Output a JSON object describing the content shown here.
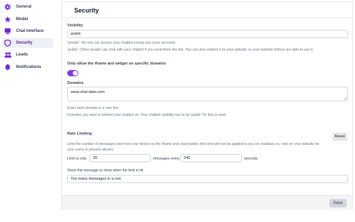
{
  "sidebar": {
    "items": [
      {
        "label": "General",
        "icon": "gear-icon"
      },
      {
        "label": "Model",
        "icon": "star-icon"
      },
      {
        "label": "Chat Interface",
        "icon": "chat-window-icon"
      },
      {
        "label": "Security",
        "icon": "shield-icon"
      },
      {
        "label": "Leads",
        "icon": "users-icon"
      },
      {
        "label": "Notifications",
        "icon": "bell-icon"
      }
    ],
    "active": "Security"
  },
  "security": {
    "title": "Security",
    "visibility": {
      "label": "Visibility",
      "value": "public",
      "help_private": "'private': No one can access your chatbot except you (your account)",
      "help_public": "'public': Other people can chat with your chatbot if you send them the link. You can also embed it on your website so your website visitors are able to use it."
    },
    "iframe": {
      "label": "Only allow the iframe and widget on specific domains",
      "enabled": true
    },
    "domains": {
      "label": "Domains",
      "value": "www.chat-data.com",
      "help_1": "Enter each domain in a new line",
      "help_2": "Domains you want to embed your chatbot on. Your chatbot visibility has to be 'public' for this to work."
    },
    "rate_limiting": {
      "label": "Rate Limiting",
      "reset_label": "Reset",
      "description_1": "Limit the number of messages sent from one device on the iframe and chat bubble (this limit will not be applied to you on chatbase.co, only on your website for",
      "description_2": "your users to prevent abuse).",
      "limit_prefix": "Limit to only",
      "messages_value": "20",
      "messages_every": "messages every",
      "seconds_value": "240",
      "seconds_suffix": "seconds."
    },
    "limit_message": {
      "label": "Show this message to show when the limit is hit",
      "value": "Too many messages in a row"
    },
    "save_label": "Save"
  },
  "colors": {
    "accent": "#7c3aed",
    "icon": "#6d28d9",
    "active_bg": "#eef0f6"
  }
}
